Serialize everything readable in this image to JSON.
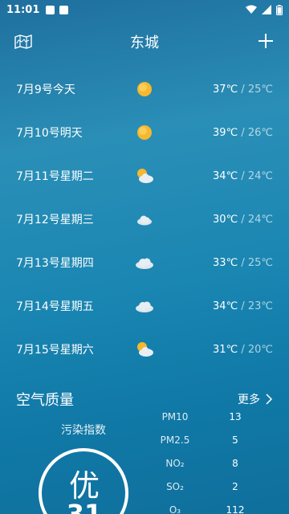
{
  "status_bar": {
    "time": "11:01"
  },
  "header": {
    "city": "东城"
  },
  "forecast": [
    {
      "label": "7月9号今天",
      "icon": "sunny-icon",
      "high": "37℃",
      "low": "25℃"
    },
    {
      "label": "7月10号明天",
      "icon": "sunny-icon",
      "high": "39℃",
      "low": "26℃"
    },
    {
      "label": "7月11号星期二",
      "icon": "partly-cloudy-icon",
      "high": "34℃",
      "low": "24℃"
    },
    {
      "label": "7月12号星期三",
      "icon": "cloudy-icon",
      "high": "30℃",
      "low": "24℃"
    },
    {
      "label": "7月13号星期四",
      "icon": "cloudy-icon",
      "high": "33℃",
      "low": "25℃"
    },
    {
      "label": "7月14号星期五",
      "icon": "cloudy-icon",
      "high": "34℃",
      "low": "23℃"
    },
    {
      "label": "7月15号星期六",
      "icon": "partly-cloudy-icon",
      "high": "31℃",
      "low": "20℃"
    }
  ],
  "air_quality": {
    "title": "空气质量",
    "more": "更多",
    "index_label": "污染指数",
    "level": "优",
    "value": "31",
    "pollutants": [
      {
        "name": "PM10",
        "value": "13"
      },
      {
        "name": "PM2.5",
        "value": "5"
      },
      {
        "name": "NO₂",
        "value": "8"
      },
      {
        "name": "SO₂",
        "value": "2"
      },
      {
        "name": "O₃",
        "value": "112"
      }
    ]
  },
  "colors": {
    "sun": "#f5b82e",
    "cloud": "#e8eef3",
    "ring": "#ffffff"
  }
}
